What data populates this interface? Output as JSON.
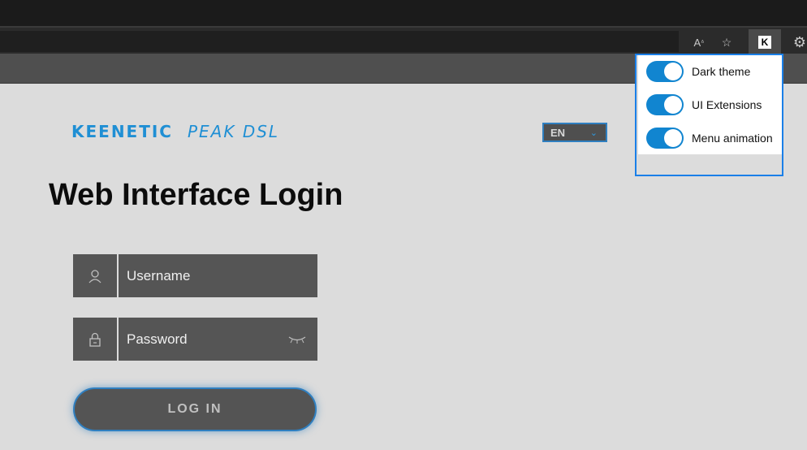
{
  "browser": {
    "read_aloud_icon": "Aᴺ",
    "favorites_icon": "☆",
    "extension_icon": "K",
    "settings_icon": "⚙"
  },
  "logo": {
    "brand": "KEENETIC",
    "model": "PEAK DSL"
  },
  "language": {
    "value": "EN",
    "chevron": "∨"
  },
  "login": {
    "heading": "Web Interface Login",
    "username_placeholder": "Username",
    "password_placeholder": "Password",
    "button_label": "LOG IN",
    "user_icon": "☺",
    "lock_icon": "ὑ2",
    "eye_icon": "‒‒"
  },
  "extension_popup": {
    "toggles": [
      {
        "label": "Dark theme",
        "on": true
      },
      {
        "label": "UI Extensions",
        "on": true
      },
      {
        "label": "Menu animation",
        "on": true
      }
    ]
  },
  "colors": {
    "accent": "#1185d0",
    "brand": "#1f8fd4",
    "popup_border": "#1a7fe8"
  }
}
